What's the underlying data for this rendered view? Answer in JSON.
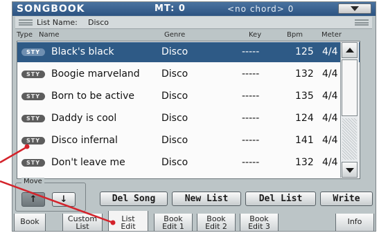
{
  "header": {
    "title": "SONGBOOK",
    "mt": "MT: 0",
    "chord": "<no chord> 0"
  },
  "list_name": {
    "label": "List Name:",
    "value": "Disco"
  },
  "columns": [
    "Type",
    "Name",
    "Genre",
    "Key",
    "Bpm",
    "Meter"
  ],
  "rows": [
    {
      "type": "STY",
      "name": "Black's black",
      "genre": "Disco",
      "key": "-----",
      "bpm": "125",
      "meter": "4/4",
      "selected": true
    },
    {
      "type": "STY",
      "name": "Boogie marveland",
      "genre": "Disco",
      "key": "-----",
      "bpm": "132",
      "meter": "4/4"
    },
    {
      "type": "STY",
      "name": "Born to be active",
      "genre": "Disco",
      "key": "-----",
      "bpm": "135",
      "meter": "4/4"
    },
    {
      "type": "STY",
      "name": "Daddy is cool",
      "genre": "Disco",
      "key": "-----",
      "bpm": "124",
      "meter": "4/4"
    },
    {
      "type": "STY",
      "name": "Disco infernal",
      "genre": "Disco",
      "key": "-----",
      "bpm": "141",
      "meter": "4/4"
    },
    {
      "type": "STY",
      "name": "Don't leave me",
      "genre": "Disco",
      "key": "-----",
      "bpm": "132",
      "meter": "4/4"
    }
  ],
  "move": {
    "label": "Move",
    "up_icon": "arrow-up-icon",
    "down_icon": "arrow-down-icon"
  },
  "buttons": {
    "del_song": "Del Song",
    "new_list": "New List",
    "del_list": "Del List",
    "write": "Write"
  },
  "tabs": [
    {
      "line1": "Book",
      "line2": ""
    },
    {
      "line1": "Custom",
      "line2": "List"
    },
    {
      "line1": "List",
      "line2": "Edit",
      "active": true
    },
    {
      "line1": "Book",
      "line2": "Edit 1"
    },
    {
      "line1": "Book",
      "line2": "Edit 2"
    },
    {
      "line1": "Book",
      "line2": "Edit 3"
    },
    {
      "line1": "Info",
      "line2": ""
    }
  ],
  "colors": {
    "title_bar": "#2c5381",
    "selected_row": "#2e5a86",
    "screen_bg": "#bcc5c7",
    "annotation_arrow": "#d4232b"
  }
}
